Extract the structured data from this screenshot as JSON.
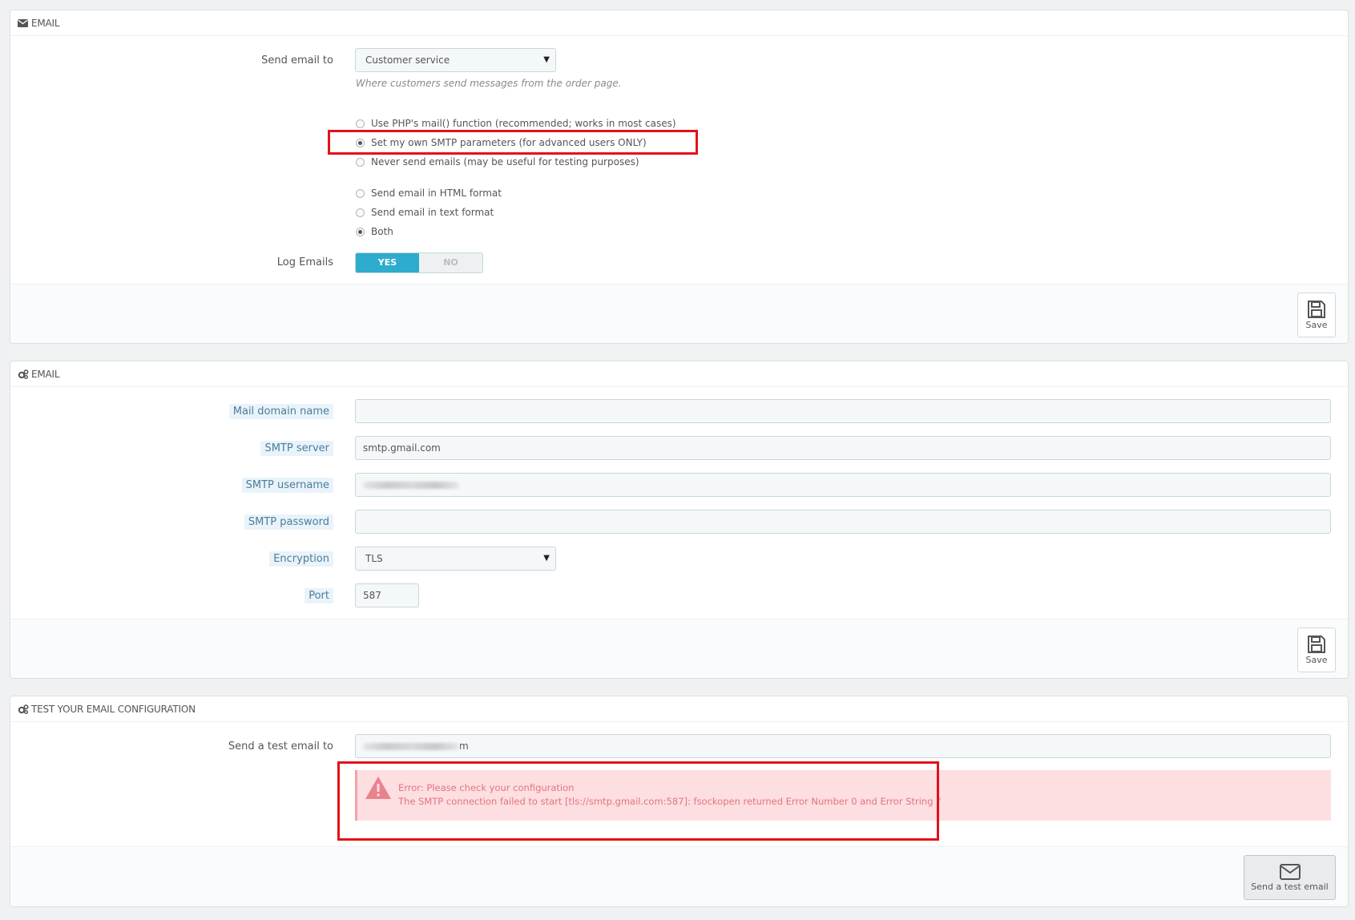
{
  "email_panel": {
    "title": "EMAIL",
    "send_email_to_label": "Send email to",
    "send_email_to_value": "Customer service",
    "send_email_to_help": "Where customers send messages from the order page.",
    "mail_method_options": [
      {
        "label": "Use PHP's mail() function (recommended; works in most cases)",
        "selected": false
      },
      {
        "label": "Set my own SMTP parameters (for advanced users ONLY)",
        "selected": true
      },
      {
        "label": "Never send emails (may be useful for testing purposes)",
        "selected": false
      }
    ],
    "format_options": [
      {
        "label": "Send email in HTML format",
        "selected": false
      },
      {
        "label": "Send email in text format",
        "selected": false
      },
      {
        "label": "Both",
        "selected": true
      }
    ],
    "log_emails_label": "Log Emails",
    "log_yes": "YES",
    "log_no": "NO",
    "log_value": "YES",
    "save_label": "Save"
  },
  "smtp_panel": {
    "title": "EMAIL",
    "mail_domain_label": "Mail domain name",
    "mail_domain_value": "",
    "smtp_server_label": "SMTP server",
    "smtp_server_value": "smtp.gmail.com",
    "smtp_username_label": "SMTP username",
    "smtp_password_label": "SMTP password",
    "smtp_password_value": "",
    "encryption_label": "Encryption",
    "encryption_value": "TLS",
    "port_label": "Port",
    "port_value": "587",
    "save_label": "Save"
  },
  "test_panel": {
    "title": "TEST YOUR EMAIL CONFIGURATION",
    "send_test_label": "Send a test email to",
    "send_test_value_visible_suffix": "m",
    "error_line1": "Error: Please check your configuration",
    "error_line2": "The SMTP connection failed to start [tls://smtp.gmail.com:587]: fsockopen returned Error Number 0 and Error String ''",
    "send_button_label": "Send a test email"
  },
  "colors": {
    "accent": "#2eacce",
    "highlight_box": "#e3121a",
    "error_bg": "#fddee1",
    "error_text": "#e0767f"
  }
}
